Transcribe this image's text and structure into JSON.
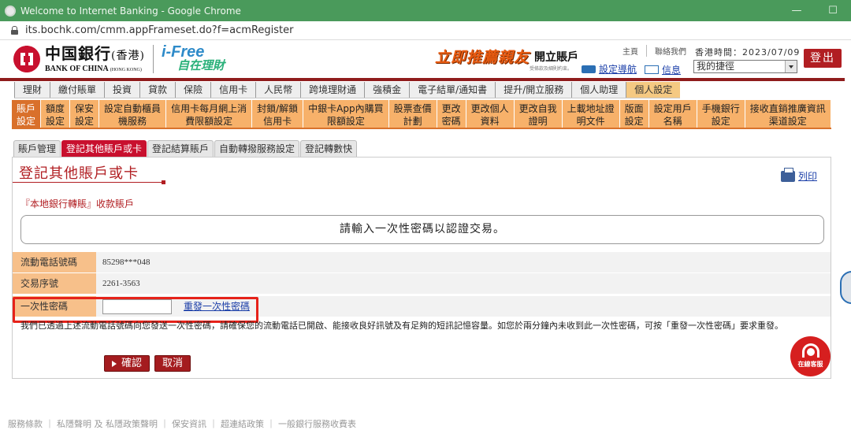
{
  "browser": {
    "title": "Welcome to Internet Banking - Google Chrome",
    "url": "its.bochk.com/cmm.appFrameset.do?f=acmRegister",
    "window_controls": [
      "—",
      "☐"
    ]
  },
  "header": {
    "logo_cn": "中国銀行",
    "logo_cn_suffix": "(香港)",
    "logo_en": "BANK OF CHINA",
    "logo_en_suffix": "(HONG KONG)",
    "ifree_en": "i-Free",
    "ifree_cn": "自在理財",
    "promo_big": "立即推薦親友",
    "promo_acct": "開立賬戶",
    "promo_tiny": "受條款及細則約束。",
    "nav_guide": "設定導航",
    "toplinks": [
      "主頁",
      "聯絡我們"
    ],
    "info": "信息",
    "hk_time": "香港時間：2023/07/09",
    "quick_select": "我的捷徑",
    "logout": "登出"
  },
  "main_menu": {
    "items": [
      "理財",
      "繳付賬單",
      "投資",
      "貸款",
      "保險",
      "信用卡",
      "人民幣",
      "跨境理財通",
      "強積金",
      "電子結單/通知書",
      "提升/開立服務",
      "個人助理",
      "個人設定"
    ],
    "active": "個人設定"
  },
  "sub_menu": {
    "items": [
      "賬戶\n設定",
      "額度\n設定",
      "保安\n設定",
      "設定自動櫃員\n機服務",
      "信用卡每月網上消\n費限額設定",
      "封鎖/解鎖\n信用卡",
      "中銀卡App內購買\n限額設定",
      "股票查價\n計劃",
      "更改\n密碼",
      "更改個人\n資料",
      "更改自我\n證明",
      "上載地址證\n明文件",
      "版面\n設定",
      "設定用戶\n名稱",
      "手機銀行\n設定",
      "接收直銷推廣資訊\n渠道設定"
    ],
    "active": "賬戶\n設定"
  },
  "tabs": {
    "items": [
      "賬戶管理",
      "登記其他賬戶或卡",
      "登記結算賬戶",
      "自動轉撥服務設定",
      "登記轉數快"
    ],
    "active": "登記其他賬戶或卡"
  },
  "content": {
    "page_title": "登記其他賬戶或卡",
    "print": "列印",
    "subhead": "『本地銀行轉賬』收款賬戶",
    "otp_banner": "請輸入一次性密碼以認證交易。",
    "rows": [
      {
        "label": "流動電話號碼",
        "value": "85298***048"
      },
      {
        "label": "交易序號",
        "value": "2261-3563"
      },
      {
        "label": "一次性密碼",
        "value": ""
      }
    ],
    "resend_otp": "重發一次性密碼",
    "note": "我們已透過上述流動電話號碼向您發送一次性密碼，請確保您的流動電話已開啟、能接收良好訊號及有足夠的短訊記憶容量。如您於兩分鐘內未收到此一次性密碼，可按「重發一次性密碼」要求重發。",
    "confirm": "確認",
    "cancel": "取消"
  },
  "chat": {
    "label": "在線客服"
  },
  "footer": {
    "text": "服務條款 ｜ 私隱聲明 及 私隱政策聲明 ｜ 保安資訊 ｜ 超連結政策 ｜ 一般銀行服務收費表"
  },
  "colors": {
    "brand_red": "#b11e22",
    "menu_orange": "#f7b16a",
    "highlight_red": "#e6221a",
    "chrome_green": "#4a9a5b"
  }
}
